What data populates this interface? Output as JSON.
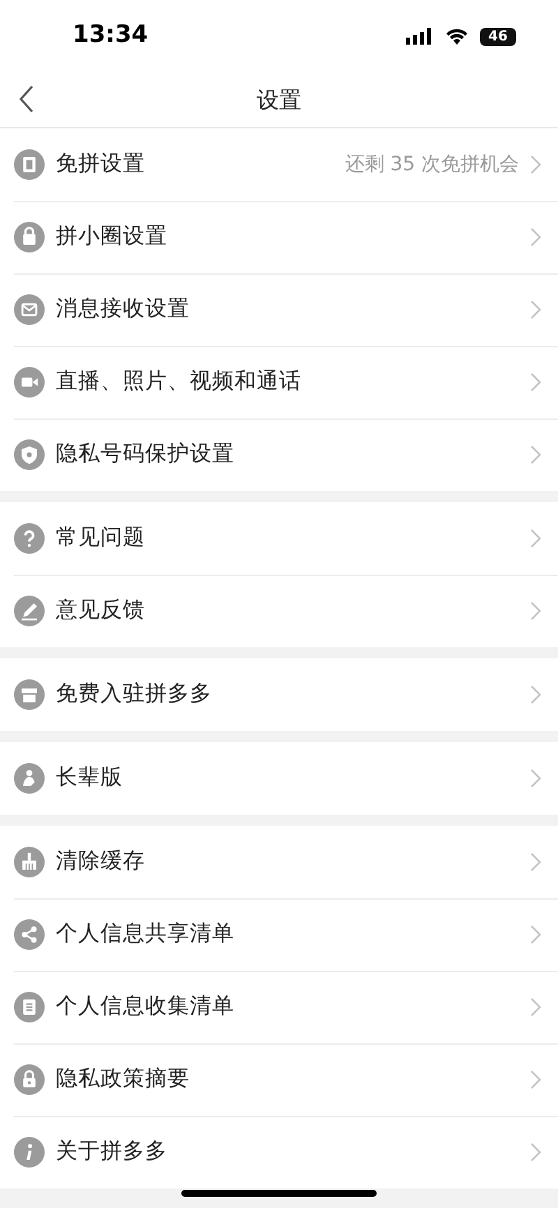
{
  "status_bar": {
    "time": "13:34",
    "battery": "46"
  },
  "header": {
    "title": "设置"
  },
  "groups": [
    {
      "items": [
        {
          "label": "免拼设置",
          "value": "还剩 35 次免拼机会"
        },
        {
          "label": "拼小圈设置"
        },
        {
          "label": "消息接收设置"
        },
        {
          "label": "直播、照片、视频和通话"
        },
        {
          "label": "隐私号码保护设置"
        }
      ]
    },
    {
      "items": [
        {
          "label": "常见问题"
        },
        {
          "label": "意见反馈"
        }
      ]
    },
    {
      "items": [
        {
          "label": "免费入驻拼多多"
        }
      ]
    },
    {
      "items": [
        {
          "label": "长辈版"
        }
      ]
    },
    {
      "items": [
        {
          "label": "清除缓存"
        },
        {
          "label": "个人信息共享清单"
        },
        {
          "label": "个人信息收集清单"
        },
        {
          "label": "隐私政策摘要"
        },
        {
          "label": "关于拼多多"
        }
      ]
    }
  ]
}
